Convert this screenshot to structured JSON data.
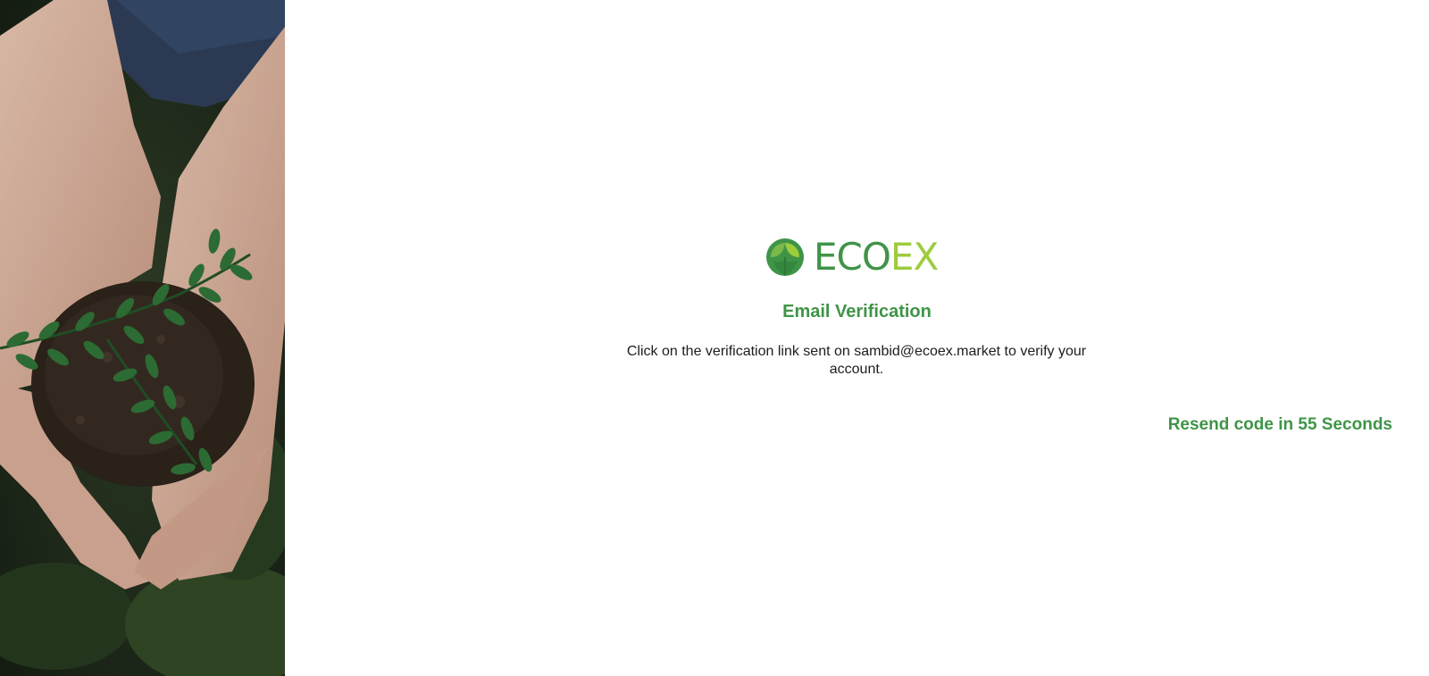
{
  "brand": {
    "logo_text_primary": "ECO",
    "logo_text_secondary": "EX",
    "colors": {
      "primary_green": "#3f9447",
      "accent_lime": "#9dcc3c",
      "text_dark": "#1d1d1d"
    }
  },
  "hero": {
    "icon": "hands-holding-plant-photo"
  },
  "verification": {
    "title": "Email Verification",
    "message": "Click on the verification link sent on sambid@ecoex.market to verify your account.",
    "resend_label": "Resend code in 55 Seconds"
  }
}
